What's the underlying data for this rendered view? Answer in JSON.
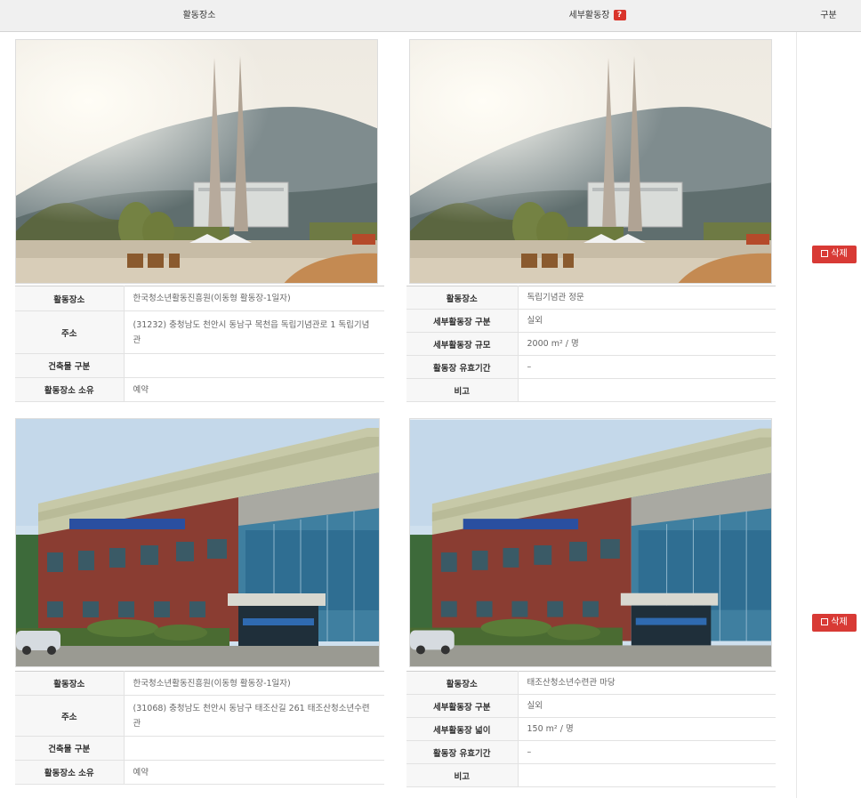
{
  "header": {
    "col_location": "활동장소",
    "col_sub_location": "세부활동장",
    "help_badge": "?",
    "col_category": "구분"
  },
  "delete_label": "삭제",
  "rows": [
    {
      "location": [
        {
          "k": "활동장소",
          "v": "한국청소년활동진흥원(이동형 활동장-1일자)"
        },
        {
          "k": "주소",
          "v": "(31232) 충청남도 천안시 동남구 목천읍 독립기념관로 1 독립기념관"
        },
        {
          "k": "건축물 구분",
          "v": ""
        },
        {
          "k": "활동장소 소유",
          "v": "예약"
        }
      ],
      "sub": [
        {
          "k": "활동장소",
          "v": "독립기념관 정문"
        },
        {
          "k": "세부활동장 구분",
          "v": "실외"
        },
        {
          "k": "세부활동장 규모",
          "v": "2000 m² / 명"
        },
        {
          "k": "활동장 유효기간",
          "v": "–"
        },
        {
          "k": "비고",
          "v": ""
        }
      ]
    },
    {
      "location": [
        {
          "k": "활동장소",
          "v": "한국청소년활동진흥원(이동형 활동장-1일자)"
        },
        {
          "k": "주소",
          "v": "(31068) 충청남도 천안시 동남구 태조산길 261 태조산청소년수련관"
        },
        {
          "k": "건축물 구분",
          "v": ""
        },
        {
          "k": "활동장소 소유",
          "v": "예약"
        }
      ],
      "sub": [
        {
          "k": "활동장소",
          "v": "태조산청소년수련관 마당"
        },
        {
          "k": "세부활동장 구분",
          "v": "실외"
        },
        {
          "k": "세부활동장 넓이",
          "v": "150 m² / 명"
        },
        {
          "k": "활동장 유효기간",
          "v": "–"
        },
        {
          "k": "비고",
          "v": ""
        }
      ]
    }
  ]
}
